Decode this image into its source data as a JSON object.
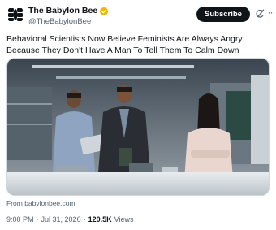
{
  "author": {
    "display_name": "The Babylon Bee",
    "handle": "@TheBabylonBee",
    "verified": true,
    "verified_color": "#f4b400",
    "avatar_icon": "babylon-bee-logo"
  },
  "actions": {
    "subscribe_label": "Subscribe",
    "grok_icon": "grok-icon",
    "more_icon": "more-icon",
    "more_label": "···"
  },
  "tweet": {
    "text": "Behavioral Scientists Now Believe Feminists Are Always Angry Because They Don't Have A Man To Tell Them To Calm Down"
  },
  "media": {
    "description_icon": "article-thumbnail-image"
  },
  "link_card": {
    "source": "From babylonbee.com"
  },
  "meta": {
    "time": "9:00 PM",
    "separator": "·",
    "date": "Jul 31, 2026",
    "views_count": "120.5K",
    "views_label": "Views"
  },
  "colors": {
    "text_primary": "#0f1419",
    "text_secondary": "#536471",
    "subscribe_bg": "#0f1419"
  }
}
